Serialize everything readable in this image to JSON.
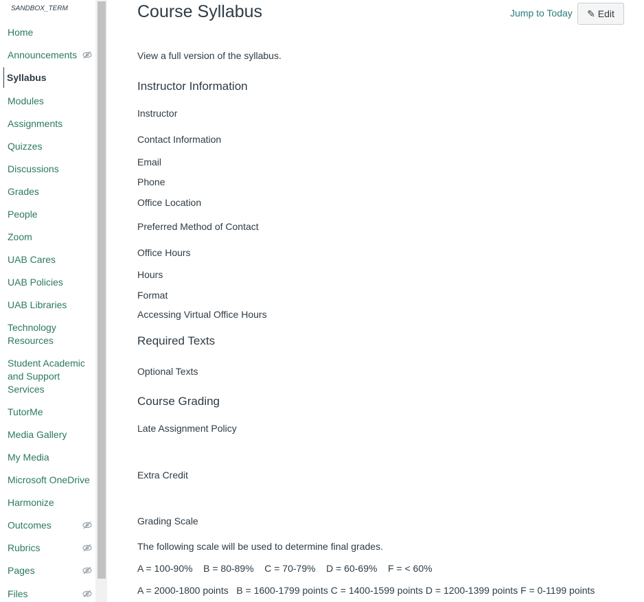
{
  "sidebar": {
    "term_label": "SANDBOX_TERM",
    "items": [
      {
        "label": "Home",
        "hidden_icon": false
      },
      {
        "label": "Announcements",
        "hidden_icon": true
      },
      {
        "label": "Syllabus",
        "active": true
      },
      {
        "label": "Modules"
      },
      {
        "label": "Assignments"
      },
      {
        "label": "Quizzes"
      },
      {
        "label": "Discussions"
      },
      {
        "label": "Grades"
      },
      {
        "label": "People"
      },
      {
        "label": "Zoom"
      },
      {
        "label": "UAB Cares"
      },
      {
        "label": "UAB Policies"
      },
      {
        "label": "UAB Libraries"
      },
      {
        "label": "Technology Resources"
      },
      {
        "label": "Student Academic and Support Services"
      },
      {
        "label": "TutorMe"
      },
      {
        "label": "Media Gallery"
      },
      {
        "label": "My Media"
      },
      {
        "label": "Microsoft OneDrive"
      },
      {
        "label": "Harmonize"
      },
      {
        "label": "Outcomes",
        "hidden_icon": true
      },
      {
        "label": "Rubrics",
        "hidden_icon": true
      },
      {
        "label": "Pages",
        "hidden_icon": true
      },
      {
        "label": "Files",
        "hidden_icon": true
      }
    ]
  },
  "header": {
    "title": "Course Syllabus",
    "jump_label": "Jump to Today",
    "edit_label": "Edit"
  },
  "content": {
    "intro": "View a full version of the syllabus.",
    "instructor_info": "Instructor Information",
    "instructor": "Instructor",
    "contact_info": "Contact Information",
    "email": "Email",
    "phone": "Phone",
    "office_location": "Office Location",
    "preferred_contact": "Preferred Method of Contact",
    "office_hours": "Office Hours",
    "hours": "Hours",
    "format": "Format",
    "virtual_hours": "Accessing Virtual Office Hours",
    "required_texts": "Required Texts",
    "optional_texts": "Optional Texts",
    "course_grading": "Course Grading",
    "late_policy": "Late Assignment Policy",
    "extra_credit": "Extra Credit",
    "grading_scale": "Grading Scale",
    "scale_intro": "The following scale will be used to determine final grades.",
    "percent_scale": "A = 100-90%    B = 80-89%    C = 70-79%    D = 60-69%    F = < 60%",
    "points_scale": "A = 2000-1800 points   B = 1600-1799 points C = 1400-1599 points D = 1200-1399 points F = 0-1199 points"
  }
}
